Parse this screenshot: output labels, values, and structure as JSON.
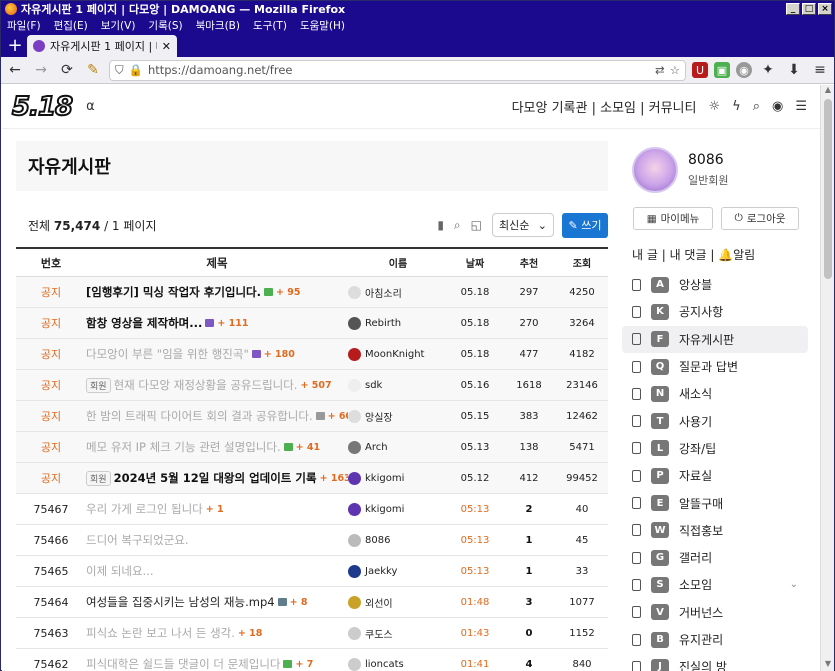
{
  "window": {
    "title": "자유게시판 1 페이지 | 다모앙 | DAMOANG — Mozilla Firefox"
  },
  "menu": [
    "파일(F)",
    "편집(E)",
    "보기(V)",
    "기록(S)",
    "북마크(B)",
    "도구(T)",
    "도움말(H)"
  ],
  "tab": {
    "title": "자유게시판 1 페이지 | 다모앙"
  },
  "url": {
    "text": "https://damoang.net/free"
  },
  "site": {
    "logo": "5.18",
    "alpha": "α",
    "nav": "다모앙 기록관 | 소모임 | 커뮤니티"
  },
  "board": {
    "title": "자유게시판",
    "count_label": "전체",
    "count": "75,474",
    "page_info": "/ 1 페이지",
    "sort": "최신순",
    "write": "쓰기"
  },
  "columns": {
    "no": "번호",
    "title": "제목",
    "name": "이름",
    "date": "날짜",
    "rec": "추천",
    "view": "조회"
  },
  "rows": [
    {
      "no": "공지",
      "title": "[임행후기] 믹싱 작업자 후기입니다.",
      "badge": "",
      "comments": "+ 95",
      "name": "아침소리",
      "date": "05.18",
      "rec": "297",
      "view": "4250",
      "style": "bold",
      "notice": true
    },
    {
      "no": "공지",
      "title": "함창 영상을 제작하며...",
      "badge": "",
      "comments": "+ 111",
      "name": "Rebirth",
      "date": "05.18",
      "rec": "270",
      "view": "3264",
      "style": "bold",
      "notice": true
    },
    {
      "no": "공지",
      "title": "다모앙이 부른 \"임을 위한 행진곡\"",
      "badge": "",
      "comments": "+ 180",
      "name": "MoonKnight",
      "date": "05.18",
      "rec": "477",
      "view": "4182",
      "style": "faded",
      "notice": true
    },
    {
      "no": "공지",
      "title": "현재 다모앙 재정상황을 공유드립니다.",
      "badge": "회원",
      "comments": "+ 507",
      "name": "sdk",
      "date": "05.16",
      "rec": "1618",
      "view": "23146",
      "style": "faded",
      "notice": true
    },
    {
      "no": "공지",
      "title": "한 밤의 트래픽 다이어트 회의 결과 공유합니다.",
      "badge": "",
      "comments": "+ 60",
      "name": "앙실장",
      "date": "05.15",
      "rec": "383",
      "view": "12462",
      "style": "faded",
      "notice": true
    },
    {
      "no": "공지",
      "title": "메모 유저 IP 체크 기능 관련 설명입니다.",
      "badge": "",
      "comments": "+ 41",
      "name": "Arch",
      "date": "05.13",
      "rec": "138",
      "view": "5471",
      "style": "faded",
      "notice": true
    },
    {
      "no": "공지",
      "title": "2024년 5월 12일 대왕의 업데이트 기록",
      "badge": "회원",
      "comments": "+ 163",
      "name": "kkigomi",
      "date": "05.12",
      "rec": "412",
      "view": "99452",
      "style": "bold",
      "notice": true
    },
    {
      "no": "75467",
      "title": "우리 가게 로그인 됩니다",
      "badge": "",
      "comments": "+ 1",
      "name": "kkigomi",
      "date": "05:13",
      "rec": "2",
      "view": "40",
      "style": "faded",
      "notice": false
    },
    {
      "no": "75466",
      "title": "드디어 복구되었군요.",
      "badge": "",
      "comments": "",
      "name": "8086",
      "date": "05:13",
      "rec": "1",
      "view": "45",
      "style": "faded",
      "notice": false
    },
    {
      "no": "75465",
      "title": "이제 되네요...",
      "badge": "",
      "comments": "",
      "name": "Jaekky",
      "date": "05:13",
      "rec": "1",
      "view": "33",
      "style": "faded",
      "notice": false
    },
    {
      "no": "75464",
      "title": "여성들을 집중시키는 남성의 재능.mp4",
      "badge": "",
      "comments": "+ 8",
      "name": "외선이",
      "date": "01:48",
      "rec": "3",
      "view": "1077",
      "style": "normal",
      "notice": false
    },
    {
      "no": "75463",
      "title": "피식쇼 논란 보고 나서 든 생각.",
      "badge": "",
      "comments": "+ 18",
      "name": "쿠도스",
      "date": "01:43",
      "rec": "0",
      "view": "1152",
      "style": "faded",
      "notice": false
    },
    {
      "no": "75462",
      "title": "피식대학은 쉴드들 댓글이 더 문제입니다",
      "badge": "",
      "comments": "+ 7",
      "name": "lioncats",
      "date": "01:41",
      "rec": "4",
      "view": "840",
      "style": "faded",
      "notice": false
    }
  ],
  "profile": {
    "name": "8086",
    "level": "일반회원",
    "menu_btn": "마이메뉴",
    "logout_btn": "로그아웃",
    "links": "내 글 | 내 댓글 | 🔔알림"
  },
  "side_menu": [
    {
      "letter": "A",
      "label": "앙상블",
      "color": "#777"
    },
    {
      "letter": "K",
      "label": "공지사항",
      "color": "#777"
    },
    {
      "letter": "F",
      "label": "자유게시판",
      "color": "#777"
    },
    {
      "letter": "Q",
      "label": "질문과 답변",
      "color": "#777"
    },
    {
      "letter": "N",
      "label": "새소식",
      "color": "#777"
    },
    {
      "letter": "T",
      "label": "사용기",
      "color": "#777"
    },
    {
      "letter": "L",
      "label": "강좌/팁",
      "color": "#777"
    },
    {
      "letter": "P",
      "label": "자료실",
      "color": "#777"
    },
    {
      "letter": "E",
      "label": "알뜰구매",
      "color": "#777"
    },
    {
      "letter": "W",
      "label": "직접홍보",
      "color": "#777"
    },
    {
      "letter": "G",
      "label": "갤러리",
      "color": "#777"
    },
    {
      "letter": "S",
      "label": "소모임",
      "color": "#777"
    },
    {
      "letter": "V",
      "label": "거버넌스",
      "color": "#777"
    },
    {
      "letter": "B",
      "label": "유지관리",
      "color": "#777"
    },
    {
      "letter": "J",
      "label": "진실의 방",
      "color": "#777"
    }
  ],
  "colors": {
    "titlebar": "#1c0a8e",
    "accent": "#1976d2",
    "notice": "#e06b1f"
  }
}
